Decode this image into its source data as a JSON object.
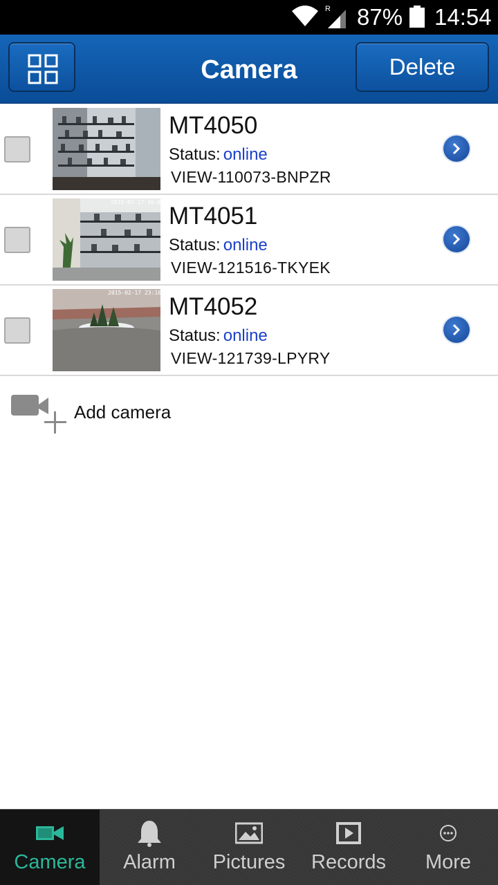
{
  "status_bar": {
    "battery": "87%",
    "time": "14:54",
    "network_label": "R"
  },
  "header": {
    "title": "Camera",
    "delete_label": "Delete"
  },
  "cameras": [
    {
      "name": "MT4050",
      "status_label": "Status:",
      "status": "online",
      "id": "VIEW-110073-BNPZR"
    },
    {
      "name": "MT4051",
      "status_label": "Status:",
      "status": "online",
      "id": "VIEW-121516-TKYEK",
      "timestamp": "2015-02-17 16:08:48"
    },
    {
      "name": "MT4052",
      "status_label": "Status:",
      "status": "online",
      "id": "VIEW-121739-LPYRY",
      "timestamp": "2015-02-17 23:10:15"
    }
  ],
  "add_camera": {
    "label": "Add camera"
  },
  "bottom_nav": [
    {
      "label": "Camera",
      "icon": "video-camera-icon",
      "active": true
    },
    {
      "label": "Alarm",
      "icon": "bell-icon",
      "active": false
    },
    {
      "label": "Pictures",
      "icon": "picture-icon",
      "active": false
    },
    {
      "label": "Records",
      "icon": "records-icon",
      "active": false
    },
    {
      "label": "More",
      "icon": "more-icon",
      "active": false
    }
  ],
  "colors": {
    "header": "#0d57a8",
    "online": "#1a3fc9",
    "active_tab": "#2bb89a"
  }
}
